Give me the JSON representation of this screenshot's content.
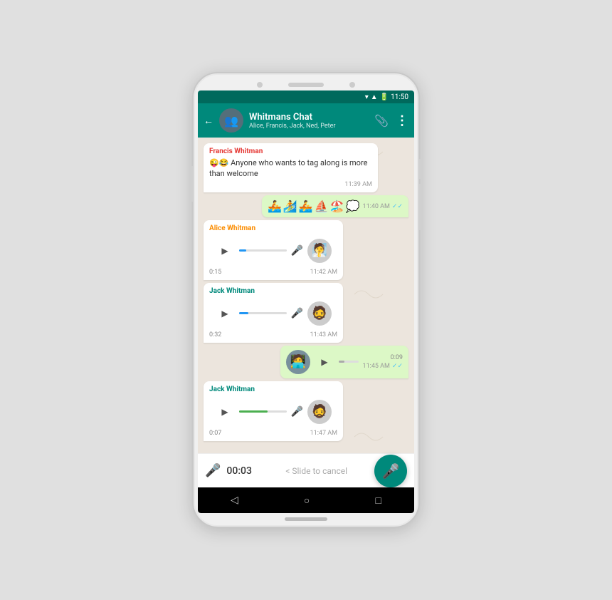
{
  "statusBar": {
    "time": "11:50"
  },
  "header": {
    "title": "Whitmans Chat",
    "subtitle": "Alice, Francis, Jack, Ned, Peter",
    "backLabel": "←",
    "attachIcon": "📎",
    "moreIcon": "⋮"
  },
  "messages": [
    {
      "id": "msg1",
      "type": "received",
      "sender": "Francis Whitman",
      "senderColor": "#e53935",
      "text": "😜😂 Anyone who wants to tag along is more than welcome",
      "time": "11:39 AM",
      "ticks": null
    },
    {
      "id": "msg2",
      "type": "sent-emoji",
      "emojis": "🚣🏄🚣⛵🏖️💭",
      "time": "11:40 AM",
      "ticks": "✓✓"
    },
    {
      "id": "msg3",
      "type": "received-audio",
      "sender": "Alice Whitman",
      "senderColor": "#fb8c00",
      "duration": "0:15",
      "time": "11:42 AM",
      "progress": 15,
      "progressColor": "blue",
      "avatarEmoji": "🧖"
    },
    {
      "id": "msg4",
      "type": "received-audio",
      "sender": "Jack Whitman",
      "senderColor": "#00897b",
      "duration": "0:32",
      "time": "11:43 AM",
      "progress": 20,
      "progressColor": "blue",
      "avatarEmoji": "🧔"
    },
    {
      "id": "msg5",
      "type": "sent-audio",
      "duration": "0:09",
      "time": "11:45 AM",
      "progress": 30,
      "progressColor": "green",
      "ticks": "✓✓",
      "avatarEmoji": "🧑‍💻"
    },
    {
      "id": "msg6",
      "type": "received-audio",
      "sender": "Jack Whitman",
      "senderColor": "#00897b",
      "duration": "0:07",
      "time": "11:47 AM",
      "progress": 60,
      "progressColor": "green",
      "avatarEmoji": "🧔"
    }
  ],
  "recording": {
    "micIcon": "🎤",
    "timer": "00:03",
    "slideLabel": "< Slide to cancel",
    "fabIcon": "🎤"
  },
  "bottomNav": {
    "back": "◁",
    "home": "○",
    "recent": "□"
  }
}
